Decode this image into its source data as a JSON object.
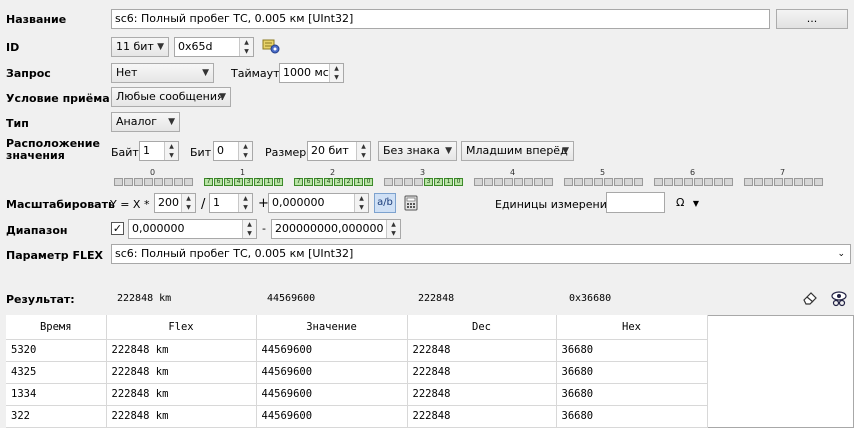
{
  "labels": {
    "name": "Название",
    "id": "ID",
    "request": "Запрос",
    "timeout": "Таймаут",
    "receive_condition": "Условие приёма",
    "type": "Тип",
    "value_location": "Расположение значения",
    "byte": "Байт",
    "bit": "Бит",
    "size": "Размер",
    "scale": "Масштабировать",
    "scale_formula": "Y = X *",
    "slash": "/",
    "plus": "+",
    "units": "Единицы измерения:",
    "range": "Диапазон",
    "range_dash": "-",
    "flex_param": "Параметр FLEX",
    "result": "Результат:"
  },
  "fields": {
    "name_value": "sc6: Полный пробег ТС, 0.005 км [UInt32]",
    "browse_button": "...",
    "id_bits": "11 бит",
    "id_value": "0x65d",
    "request_value": "Нет",
    "timeout_value": "1000 мс",
    "receive_value": "Любые сообщения",
    "type_value": "Аналог",
    "byte_value": "1",
    "bit_value": "0",
    "size_value": "20 бит",
    "sign_value": "Без знака",
    "order_value": "Младшим вперёд",
    "scale_mul": "200",
    "scale_div": "1",
    "scale_add": "0,000000",
    "units_value": "",
    "ohm_symbol": "Ω",
    "range_min": "0,000000",
    "range_max": "200000000,000000",
    "range_checked": "✓",
    "flex_value": "sc6: Полный пробег ТС, 0.005 км [UInt32]"
  },
  "bit_grid": {
    "byte_numbers": [
      "0",
      "1",
      "2",
      "3",
      "4",
      "5",
      "6",
      "7"
    ],
    "active_bits_byte1": [
      "7",
      "6",
      "5",
      "4",
      "3",
      "2",
      "1",
      "0"
    ],
    "active_bits_byte2": [
      "7",
      "6",
      "5",
      "4",
      "3",
      "2",
      "1",
      "0"
    ],
    "active_bits_byte3": [
      "3",
      "2",
      "1",
      "0"
    ]
  },
  "result": {
    "values": [
      "222848 km",
      "44569600",
      "222848",
      "0x36680"
    ]
  },
  "table": {
    "columns": [
      "Время",
      "Flex",
      "Значение",
      "Dec",
      "Hex"
    ],
    "rows": [
      [
        "5320",
        "222848 km",
        "44569600",
        "222848",
        "36680"
      ],
      [
        "4325",
        "222848 km",
        "44569600",
        "222848",
        "36680"
      ],
      [
        "1334",
        "222848 km",
        "44569600",
        "222848",
        "36680"
      ],
      [
        "322",
        "222848 km",
        "44569600",
        "222848",
        "36680"
      ]
    ]
  }
}
